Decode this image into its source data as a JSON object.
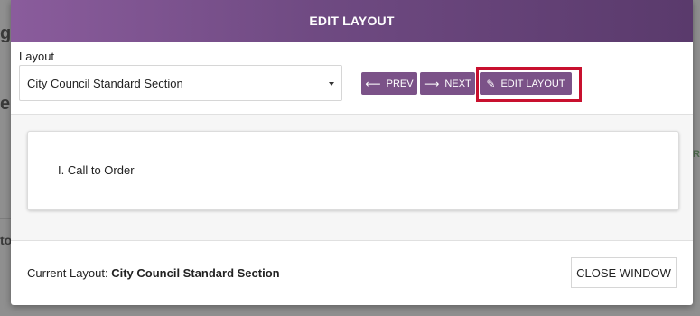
{
  "modal": {
    "title": "EDIT LAYOUT",
    "layout_label": "Layout",
    "layout_select_value": "City Council Standard Section",
    "buttons": {
      "prev": "PREV",
      "next": "NEXT",
      "edit": "EDIT LAYOUT"
    },
    "section_title": "I. Call to Order",
    "footer": {
      "current_prefix": "Current Layout:",
      "current_value": "City Council Standard Section",
      "close": "CLOSE WINDOW"
    }
  },
  "colors": {
    "accent": "#7b5288",
    "header_gradient": [
      "#8a5c9c",
      "#5a3a6c"
    ],
    "highlight": "#c8102e"
  },
  "icons": {
    "prev": "arrow-left-icon",
    "next": "arrow-right-icon",
    "edit": "pencil-icon",
    "select": "chevron-down-icon"
  },
  "background": {
    "fragments": [
      "ge",
      "eg",
      "to",
      "R"
    ]
  }
}
